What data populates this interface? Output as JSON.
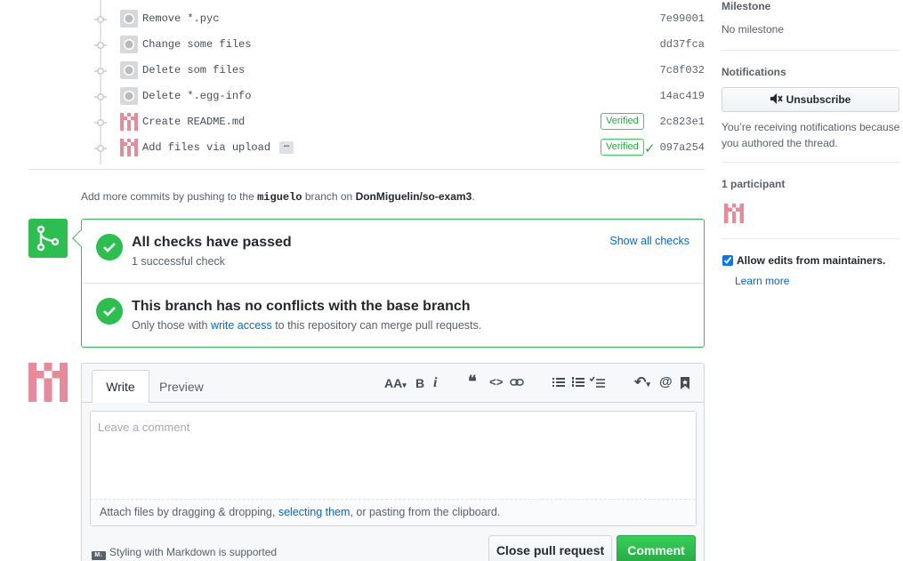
{
  "commits": [
    {
      "message": "Remove *.pyc",
      "sha": "7e99001",
      "avatar": "gray",
      "verified": false,
      "ellipsis": false,
      "check": false
    },
    {
      "message": "Change some files",
      "sha": "dd37fca",
      "avatar": "gray",
      "verified": false,
      "ellipsis": false,
      "check": false
    },
    {
      "message": "Delete som files",
      "sha": "7c8f032",
      "avatar": "gray",
      "verified": false,
      "ellipsis": false,
      "check": false
    },
    {
      "message": "Delete *.egg-info",
      "sha": "14ac419",
      "avatar": "gray",
      "verified": false,
      "ellipsis": false,
      "check": false
    },
    {
      "message": "Create README.md",
      "sha": "2c823e1",
      "avatar": "pink",
      "verified": true,
      "ellipsis": false,
      "check": false
    },
    {
      "message": "Add files via upload",
      "sha": "097a254",
      "avatar": "pink",
      "verified": true,
      "ellipsis": true,
      "check": true
    }
  ],
  "verified_label": "Verified",
  "ellipsis_label": "…",
  "add_more": {
    "prefix": "Add more commits by pushing to the ",
    "branch": "miguelo",
    "middle": " branch on ",
    "repo": "DonMiguelin/so-exam3",
    "suffix": "."
  },
  "checks": {
    "title": "All checks have passed",
    "subtitle": "1 successful check",
    "show_all": "Show all checks"
  },
  "conflicts": {
    "title": "This branch has no conflicts with the base branch",
    "sub_prefix": "Only those with ",
    "sub_link": "write access",
    "sub_suffix": " to this repository can merge pull requests."
  },
  "comment_form": {
    "tab_write": "Write",
    "tab_preview": "Preview",
    "placeholder": "Leave a comment",
    "attach_prefix": "Attach files by dragging & dropping, ",
    "attach_link": "selecting them",
    "attach_suffix": ", or pasting from the clipboard.",
    "markdown_note": "Styling with Markdown is supported",
    "close_button": "Close pull request",
    "comment_button": "Comment",
    "toolbar": {
      "header": "AA",
      "bold": "B",
      "italic": "i"
    }
  },
  "sidebar": {
    "milestone_heading": "Milestone",
    "milestone_value": "No milestone",
    "notifications_heading": "Notifications",
    "unsubscribe_label": "Unsubscribe",
    "notification_note": "You’re receiving notifications because you authored the thread.",
    "participants_heading": "1 participant",
    "allow_edits_label": "Allow edits from maintainers.",
    "learn_more": "Learn more"
  },
  "colors": {
    "success": "#2cbe4e",
    "link": "#0366d6",
    "avatar_pink": "#e88a9a"
  }
}
